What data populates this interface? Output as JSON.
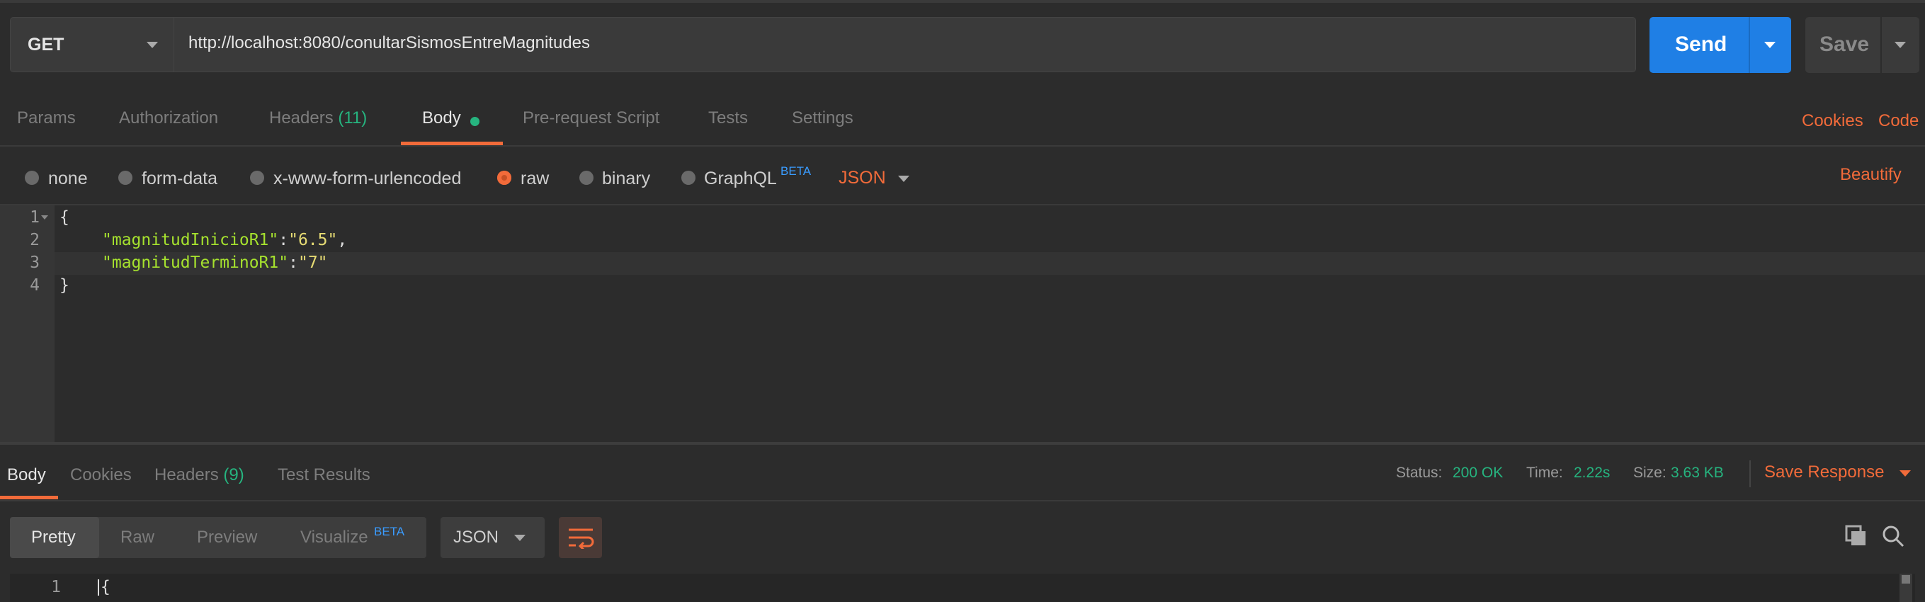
{
  "request": {
    "method": "GET",
    "url": "http://localhost:8080/conultarSismosEntreMagnitudes",
    "send_label": "Send",
    "save_label": "Save"
  },
  "request_tabs": {
    "params": "Params",
    "authorization": "Authorization",
    "headers": "Headers",
    "headers_count": "(11)",
    "body": "Body",
    "pre_request": "Pre-request Script",
    "tests": "Tests",
    "settings": "Settings",
    "cookies": "Cookies",
    "code": "Code"
  },
  "body_types": {
    "none": "none",
    "form_data": "form-data",
    "urlencoded": "x-www-form-urlencoded",
    "raw": "raw",
    "binary": "binary",
    "graphql": "GraphQL",
    "graphql_badge": "BETA",
    "format": "JSON",
    "beautify": "Beautify",
    "selected": "raw"
  },
  "editor": {
    "line_numbers": [
      "1",
      "2",
      "3",
      "4"
    ],
    "open_brace": "{",
    "key1": "\"magnitudInicioR1\"",
    "val1": "\"6.5\"",
    "key2": "\"magnitudTerminoR1\"",
    "val2": "\"7\"",
    "close_brace": "}",
    "colon": ":",
    "comma": ","
  },
  "response": {
    "tabs": {
      "body": "Body",
      "cookies": "Cookies",
      "headers": "Headers",
      "headers_count": "(9)",
      "test_results": "Test Results"
    },
    "status_label": "Status:",
    "status_value": "200 OK",
    "time_label": "Time:",
    "time_value": "2.22s",
    "size_label": "Size:",
    "size_value": "3.63 KB",
    "save_response": "Save Response",
    "view_modes": {
      "pretty": "Pretty",
      "raw": "Raw",
      "preview": "Preview",
      "visualize": "Visualize",
      "visualize_badge": "BETA"
    },
    "format": "JSON",
    "first_line_number": "1",
    "first_line_text": "{"
  },
  "colors": {
    "accent_orange": "#f26b3a",
    "send_blue": "#1f7fe5",
    "success_green": "#26b47f"
  }
}
